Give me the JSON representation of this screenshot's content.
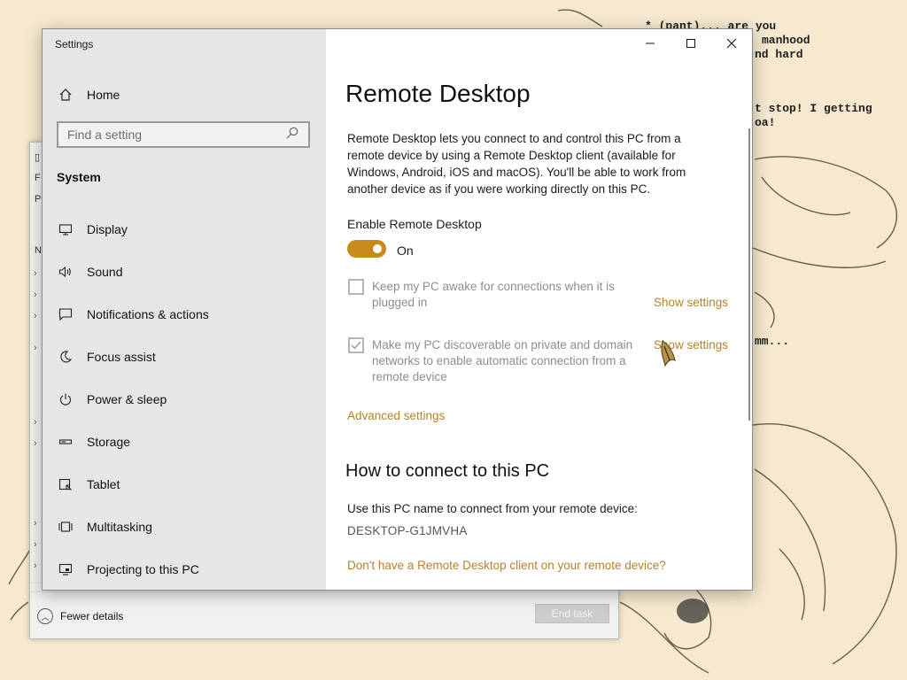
{
  "wallpaper": {
    "bg_color": "#f6e9cf",
    "comic_lines": [
      "* (pant)... are you",
      "manhood",
      "nd hard",
      "t stop! I getting",
      "oa!",
      "mm..."
    ]
  },
  "task_manager": {
    "fewer_details": "Fewer details",
    "end_task": "End task",
    "left_letters": [
      "F",
      "P",
      "N"
    ]
  },
  "settings": {
    "window_title": "Settings",
    "home_label": "Home",
    "search_placeholder": "Find a setting",
    "section": "System",
    "nav": [
      {
        "label": "Display",
        "icon": "display-icon"
      },
      {
        "label": "Sound",
        "icon": "speaker-icon"
      },
      {
        "label": "Notifications & actions",
        "icon": "notification-icon"
      },
      {
        "label": "Focus assist",
        "icon": "moon-icon"
      },
      {
        "label": "Power & sleep",
        "icon": "power-icon"
      },
      {
        "label": "Storage",
        "icon": "storage-icon"
      },
      {
        "label": "Tablet",
        "icon": "tablet-icon"
      },
      {
        "label": "Multitasking",
        "icon": "multitasking-icon"
      },
      {
        "label": "Projecting to this PC",
        "icon": "projector-icon"
      }
    ],
    "accent_color": "#c98a1c",
    "link_color": "#b7822b"
  },
  "remote_desktop": {
    "title": "Remote Desktop",
    "description": "Remote Desktop lets you connect to and control this PC from a remote device by using a Remote Desktop client (available for Windows, Android, iOS and macOS). You'll be able to work from another device as if you were working directly on this PC.",
    "enable_label": "Enable Remote Desktop",
    "toggle_state": "On",
    "keep_awake": {
      "text": "Keep my PC awake for connections when it is plugged in",
      "checked": false,
      "link": "Show settings"
    },
    "discoverable": {
      "text": "Make my PC discoverable on private and domain networks to enable automatic connection from a remote device",
      "checked": true,
      "link": "Show settings"
    },
    "advanced_settings": "Advanced settings",
    "how_to_heading": "How to connect to this PC",
    "use_name_text": "Use this PC name to connect from your remote device:",
    "pc_name": "DESKTOP-G1JMVHA",
    "client_link": "Don't have a Remote Desktop client on your remote device?"
  }
}
